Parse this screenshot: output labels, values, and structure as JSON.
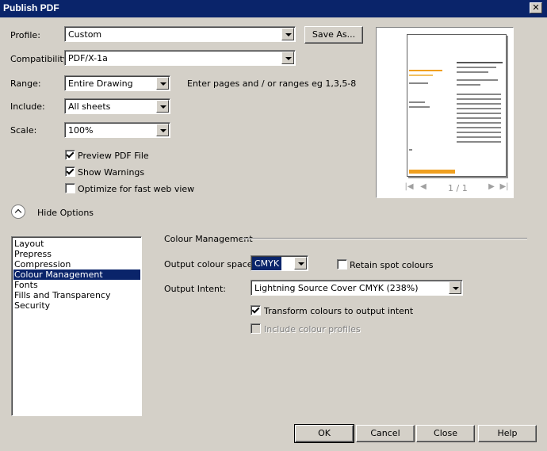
{
  "window": {
    "title": "Publish PDF",
    "close_glyph": "✕"
  },
  "profile": {
    "label": "Profile:",
    "value": "Custom",
    "save_as": "Save As..."
  },
  "compatibility": {
    "label": "Compatibility:",
    "value": "PDF/X-1a"
  },
  "range": {
    "label": "Range:",
    "value": "Entire Drawing",
    "hint": "Enter pages and / or ranges eg 1,3,5-8"
  },
  "include": {
    "label": "Include:",
    "value": "All sheets"
  },
  "scale": {
    "label": "Scale:",
    "value": "100%"
  },
  "options": {
    "preview_pdf": {
      "label": "Preview PDF File",
      "checked": true
    },
    "show_warnings": {
      "label": "Show Warnings",
      "checked": true
    },
    "optimize_web": {
      "label": "Optimize for fast web view",
      "checked": false
    }
  },
  "hide_options": "Hide Options",
  "preview": {
    "page_indicator": "1 / 1"
  },
  "categories": {
    "items": [
      "Layout",
      "Prepress",
      "Compression",
      "Colour Management",
      "Fonts",
      "Fills and Transparency",
      "Security"
    ],
    "selected": "Colour Management"
  },
  "colour_management": {
    "heading": "Colour Management",
    "output_colour_space": {
      "label": "Output colour space:",
      "value": "CMYK"
    },
    "retain_spot": {
      "label": "Retain spot colours",
      "checked": false
    },
    "output_intent": {
      "label": "Output Intent:",
      "value": "Lightning Source Cover CMYK (238%)"
    },
    "transform": {
      "label": "Transform colours to output intent",
      "checked": true
    },
    "include_profiles": {
      "label": "Include colour profiles",
      "checked": false,
      "disabled": true
    }
  },
  "buttons": {
    "ok": "OK",
    "cancel": "Cancel",
    "close": "Close",
    "help": "Help"
  },
  "colors": {
    "titlebar": "#0a246a",
    "face": "#d4d0c8",
    "selection": "#0a246a",
    "preview_accent": "#f0a020"
  }
}
